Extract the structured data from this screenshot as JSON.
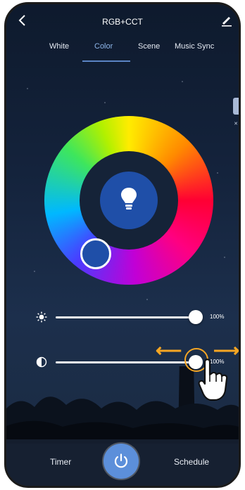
{
  "header": {
    "title": "RGB+CCT"
  },
  "tabs": [
    {
      "label": "White"
    },
    {
      "label": "Color"
    },
    {
      "label": "Scene"
    },
    {
      "label": "Music Sync"
    }
  ],
  "active_tab": "Color",
  "color_wheel": {
    "selected_color": "#1f4fa8"
  },
  "brightness": {
    "value": "100%",
    "level": 1.0
  },
  "saturation": {
    "value": "100%",
    "level": 1.0
  },
  "bottom_bar": {
    "timer_label": "Timer",
    "schedule_label": "Schedule"
  },
  "icons": [
    "back-icon",
    "edit-icon",
    "bulb-icon",
    "sun-icon",
    "contrast-icon",
    "power-icon",
    "hand-pointer-icon"
  ],
  "colors": {
    "accent": "#5c8fda",
    "guide_arrows": "#f6a623",
    "active_tab": "#8eb6ea"
  }
}
